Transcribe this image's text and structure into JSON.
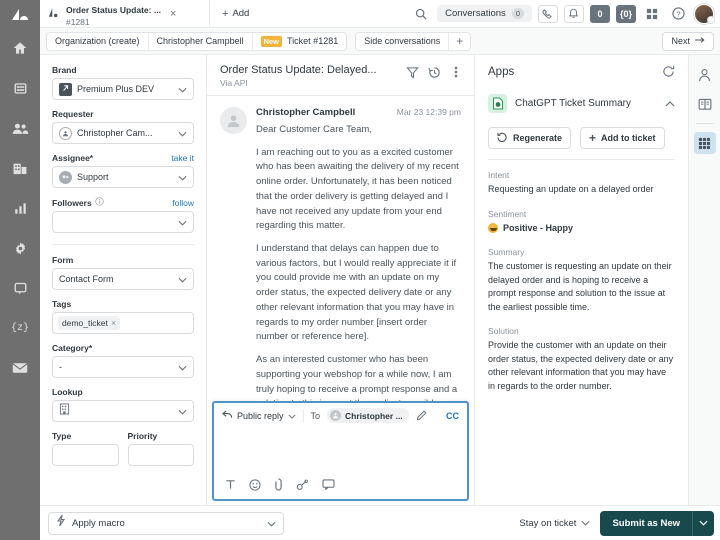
{
  "left_rail": {
    "logo": "zendesk-logo-icon",
    "items": [
      {
        "name": "home-icon",
        "label": "Home"
      },
      {
        "name": "views-icon",
        "label": "Views"
      },
      {
        "name": "customers-icon",
        "label": "Customers"
      },
      {
        "name": "organizations-icon",
        "label": "Organizations"
      },
      {
        "name": "reporting-icon",
        "label": "Reporting"
      },
      {
        "name": "gear-icon",
        "label": "Admin"
      },
      {
        "name": "chat-icon",
        "label": "Chat"
      },
      {
        "name": "api-braces-icon",
        "label": "{z}"
      },
      {
        "name": "mail-icon",
        "label": "Mail"
      }
    ]
  },
  "topbar": {
    "ticket_tab": {
      "icon": "ticket-icon",
      "title": "Order Status Update: ...",
      "subtitle": "#1281",
      "close": "×"
    },
    "add_label": "Add",
    "add_icon": "plus-icon",
    "search_icon": "search-icon",
    "conversations": {
      "label": "Conversations",
      "count": "0"
    },
    "talk_icon": "phone-icon",
    "bell_icon": "bell-icon",
    "badge_count": "0",
    "badge_braces": "{0}",
    "grid_icon": "grid-icon",
    "help_icon": "help-icon",
    "avatar": "user-avatar"
  },
  "subbar": {
    "crumbs": [
      {
        "label": "Organization (create)",
        "badge": ""
      },
      {
        "label": "Christopher Campbell",
        "badge": ""
      },
      {
        "label": "Ticket #1281",
        "badge": "New"
      }
    ],
    "side_conversations": "Side conversations",
    "add_icon": "plus-icon",
    "next_label": "Next",
    "next_icon": "arrow-right-icon"
  },
  "sidebar": {
    "brand": {
      "label": "Brand",
      "value": "Premium Plus DEV",
      "icon": "brand-icon"
    },
    "requester": {
      "label": "Requester",
      "value": "Christopher Cam...",
      "icon": "user-circle-icon"
    },
    "assignee": {
      "label": "Assignee*",
      "value": "Support",
      "link": "take it",
      "icon": "group-icon"
    },
    "followers": {
      "label": "Followers",
      "value": "",
      "link": "follow",
      "info_icon": "info-icon"
    },
    "form": {
      "label": "Form",
      "value": "Contact Form"
    },
    "tags": {
      "label": "Tags",
      "items": [
        {
          "text": "demo_ticket",
          "remove": "×"
        }
      ]
    },
    "category": {
      "label": "Category*",
      "value": "-"
    },
    "lookup": {
      "label": "Lookup",
      "value": "",
      "icon": "building-icon"
    },
    "type": {
      "label": "Type",
      "value": ""
    },
    "priority": {
      "label": "Priority",
      "value": ""
    }
  },
  "conversation": {
    "subject": "Order Status Update: Delayed...",
    "via": "Via API",
    "filter_icon": "filter-icon",
    "history_icon": "history-icon",
    "more_icon": "more-vertical-icon",
    "message": {
      "author": "Christopher Campbell",
      "timestamp": "Mar 23 12:39 pm",
      "avatar": "user-avatar-placeholder",
      "paragraphs": [
        "Dear Customer Care Team,",
        "I am reaching out to you as a excited customer who has been awaiting the delivery of my recent online order. Unfortunately, it has been noticed that the order delivery is getting delayed and I have not received any update from your end regarding this matter.",
        "I understand that delays can happen due to various factors, but I would really appreciate it if you could provide me with an update on my order status, the expected delivery date or any other relevant information that you may have in regards to my order number [insert order number or reference here].",
        "As an interested customer who has been supporting your webshop for a while now, I am truly hoping to receive a prompt response and a solution to this issue at the earliest possible time. Please let me know if"
      ]
    }
  },
  "composer": {
    "channel": "Public reply",
    "channel_icon": "reply-arrow-icon",
    "to_label": "To",
    "recipient": "Christopher ...",
    "edit_icon": "pencil-icon",
    "cc_label": "CC",
    "placeholder": "",
    "value": "",
    "tools": [
      {
        "name": "text-format-icon",
        "glyph": "T"
      },
      {
        "name": "emoji-icon",
        "glyph": "☺"
      },
      {
        "name": "attachment-icon",
        "glyph": "📎"
      },
      {
        "name": "link-icon",
        "glyph": "link"
      },
      {
        "name": "macro-comment-icon",
        "glyph": "comment"
      }
    ]
  },
  "apps": {
    "title": "Apps",
    "refresh_icon": "refresh-icon",
    "app": {
      "name": "ChatGPT Ticket Summary",
      "icon": "chatgpt-doc-icon",
      "collapse_icon": "chevron-up-icon",
      "buttons": [
        {
          "label": "Regenerate",
          "icon": "regenerate-icon"
        },
        {
          "label": "Add to ticket",
          "icon": "plus-icon"
        }
      ],
      "sections": [
        {
          "label": "Intent",
          "value": "Requesting an update on a delayed order",
          "type": "text"
        },
        {
          "label": "Sentiment",
          "value": "Positive - Happy",
          "type": "sentiment",
          "emoji": "happy-emoji"
        },
        {
          "label": "Summary",
          "value": "The customer is requesting an update on their delayed order and is hoping to receive a prompt response and solution to the issue at the earliest possible time.",
          "type": "text"
        },
        {
          "label": "Solution",
          "value": "Provide the customer with an update on their order status, the expected delivery date or any other relevant information that you may have in regards to the order number.",
          "type": "text"
        }
      ]
    }
  },
  "right_rail": {
    "items": [
      {
        "name": "user-icon",
        "active": false
      },
      {
        "name": "knowledge-book-icon",
        "active": false
      },
      {
        "name": "apps-grid-icon",
        "active": true
      }
    ]
  },
  "footer": {
    "macro": {
      "placeholder": "Apply macro",
      "icon": "macro-icon"
    },
    "stay_on_ticket": "Stay on ticket",
    "submit_label": "Submit as New",
    "submit_caret_icon": "chevron-down-icon"
  },
  "colors": {
    "rail_bg": "#6f6f6f",
    "accent_link": "#1f73b7",
    "badge_new": "#f5b33c",
    "submit_bg": "#17494d",
    "composer_border": "#5293c7",
    "badge_dark": "#68737d",
    "app_icon_bg": "#d7f0e0"
  }
}
